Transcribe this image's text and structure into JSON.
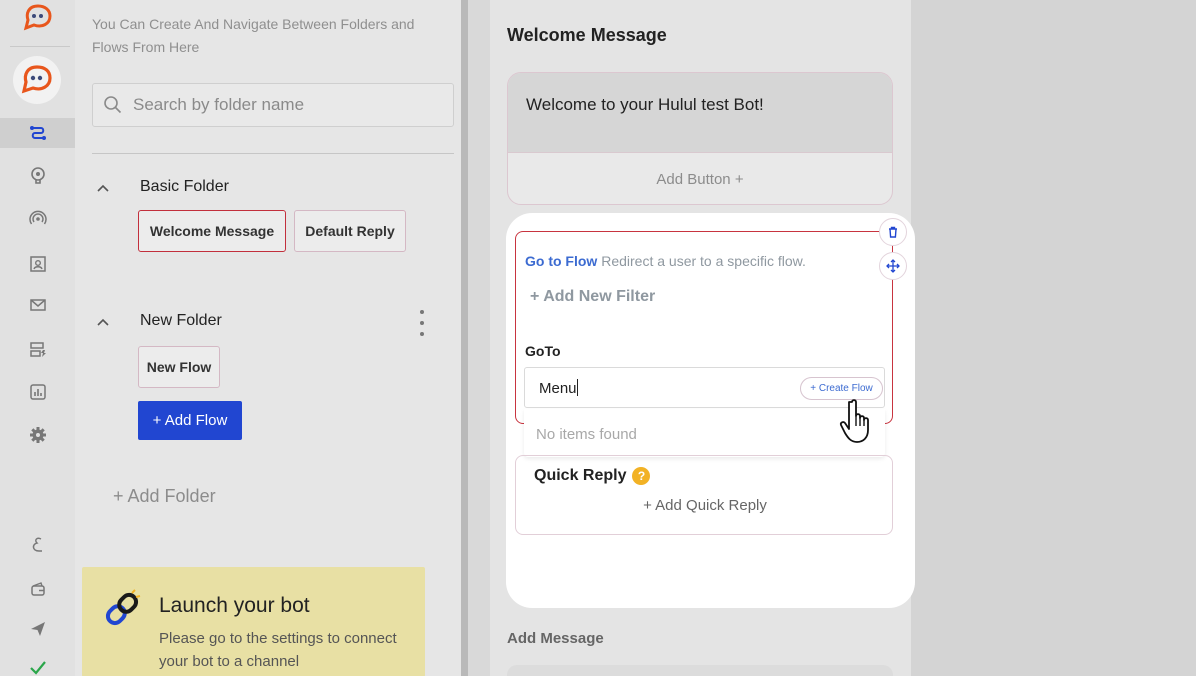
{
  "sidebar": {
    "icons": [
      "bot-logo-icon",
      "flows-icon",
      "brain-icon",
      "broadcast-icon",
      "contacts-icon",
      "mail-icon",
      "templates-icon",
      "analytics-icon",
      "settings-icon",
      "arabic-language-icon",
      "wallet-icon",
      "send-icon",
      "check-icon"
    ]
  },
  "folders_panel": {
    "hint": "You Can Create And Navigate Between Folders and Flows From Here",
    "search_placeholder": "Search by folder name",
    "folders": [
      {
        "name": "Basic Folder",
        "flows": [
          "Welcome Message",
          "Default Reply"
        ]
      },
      {
        "name": "New Folder",
        "flows": [
          "New Flow"
        ]
      }
    ],
    "add_flow_label": "+ Add Flow",
    "add_folder_label": "+ Add Folder",
    "launch": {
      "title": "Launch your bot",
      "text": "Please go to the settings to connect your bot to a channel"
    }
  },
  "editor": {
    "title": "Welcome Message",
    "message_text": "Welcome to your Hulul test Bot!",
    "add_button_label": "Add Button +",
    "goto": {
      "head_strong": "Go to Flow",
      "head_text": "Redirect a user to a specific flow.",
      "filter_label": "+ Add New Filter",
      "label": "GoTo",
      "input_value": "Menu",
      "create_flow_label": "+ Create Flow",
      "empty_text": "No items found"
    },
    "quick_reply": {
      "label": "Quick Reply",
      "help": "?",
      "add_label": "+ Add Quick Reply"
    },
    "add_message_label": "Add Message"
  },
  "colors": {
    "accent_blue": "#2146d1",
    "active_border": "#c22f3c",
    "logo_orange": "#e8561c",
    "launch_bg": "#e8e0a4"
  }
}
